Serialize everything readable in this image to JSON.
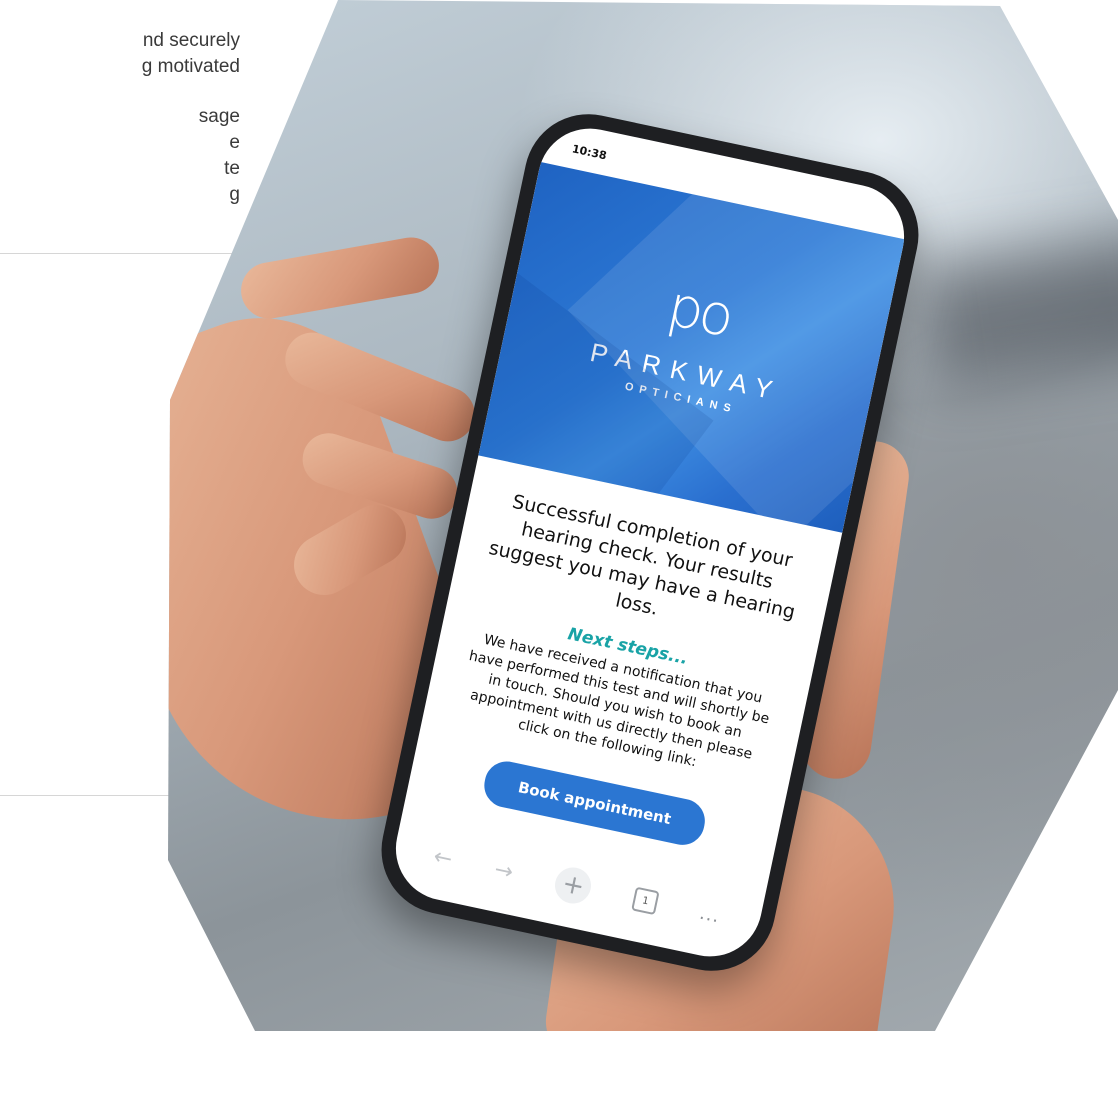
{
  "left_text": {
    "paragraph_1": [
      "nd securely",
      "g motivated"
    ],
    "paragraph_2": [
      "sage",
      "e",
      "te",
      "g"
    ]
  },
  "phone": {
    "status_time": "10:38",
    "logo": {
      "mark": "po",
      "name": "PARKWAY",
      "sub": "OPTICIANS"
    },
    "headline": "Successful completion of your hearing check. Your results suggest you may have a hearing loss.",
    "next_steps_title": "Next steps...",
    "body": "We have received a notification that you have performed this test and will shortly be in touch. Should you wish to book an appointment with us directly then please click on the following link:",
    "cta_label": "Book appointment",
    "browser_bar": {
      "tab_count": "1",
      "more": "..."
    }
  },
  "colors": {
    "brand_blue": "#2b76d2",
    "next_steps_teal": "#19a3a6"
  }
}
